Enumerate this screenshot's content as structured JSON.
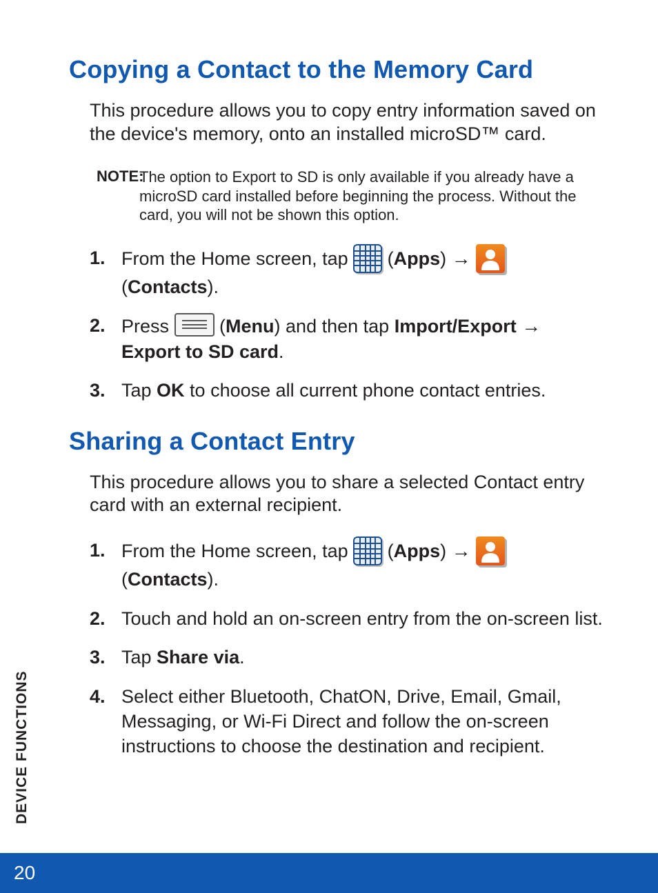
{
  "page_number": "20",
  "side_label": "DEVICE FUNCTIONS",
  "section1": {
    "heading": "Copying a Contact to the Memory Card",
    "intro": "This procedure allows you to copy entry information saved on the device's memory, onto an installed microSD™ card.",
    "note_label": "NOTE:",
    "note_body": "The option to Export to SD is only available if you already have a microSD card installed before beginning the process. Without the card, you will not be shown this option.",
    "steps": {
      "s1_a": "From the Home screen, tap ",
      "s1_apps": "Apps",
      "s1_b": " (",
      "s1_c": ") ",
      "s1_contacts": "Contacts",
      "s1_d": " (",
      "s1_e": ").",
      "s2_a": "Press ",
      "s2_menu": "Menu",
      "s2_b": " (",
      "s2_c": ") and then tap ",
      "s2_import": "Import/Export",
      "s2_d": " ",
      "s2_export": "Export to SD card",
      "s2_e": ".",
      "s3_a": "Tap ",
      "s3_ok": "OK",
      "s3_b": " to choose all current phone contact entries."
    }
  },
  "section2": {
    "heading": "Sharing a Contact Entry",
    "intro": "This procedure allows you to share a selected Contact entry card with an external recipient.",
    "steps": {
      "s1_a": "From the Home screen, tap ",
      "s1_apps": "Apps",
      "s1_b": " (",
      "s1_c": ") ",
      "s1_contacts": "Contacts",
      "s1_d": " (",
      "s1_e": ").",
      "s2": "Touch and hold an on-screen entry from the on-screen list.",
      "s3_a": "Tap ",
      "s3_share": "Share via",
      "s3_b": ".",
      "s4": "Select either Bluetooth, ChatON, Drive, Email, Gmail, Messaging, or Wi-Fi Direct and follow the on-screen instructions to choose the destination and recipient."
    }
  },
  "arrow": "→"
}
